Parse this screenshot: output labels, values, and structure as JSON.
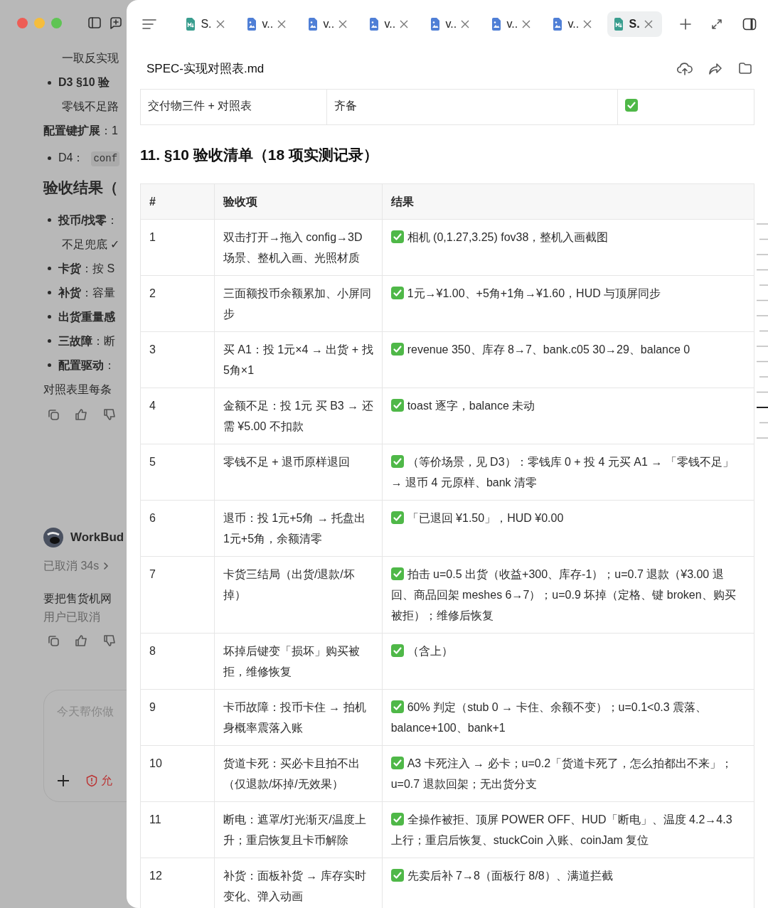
{
  "chat": {
    "blocks": [
      {
        "kind": "line",
        "text": "一取反实现"
      },
      {
        "kind": "bullet",
        "lines": [
          "**D3 §10 验**",
          "零钱不足路"
        ]
      },
      {
        "kind": "para",
        "text": "**配置键扩展**：1"
      },
      {
        "kind": "bullet",
        "lines": [
          "D4："
        ],
        "code": "conf"
      },
      {
        "kind": "heading",
        "text": "验收结果（"
      },
      {
        "kind": "bullet",
        "lines": [
          "**投币/找零**：",
          "不足兜底 ✓"
        ]
      },
      {
        "kind": "bullet",
        "lines": [
          "**卡货**：按 S"
        ]
      },
      {
        "kind": "bullet",
        "lines": [
          "**补货**：容量"
        ]
      },
      {
        "kind": "bullet",
        "lines": [
          "**出货重量感**"
        ]
      },
      {
        "kind": "bullet",
        "lines": [
          "**三故障**：断"
        ]
      },
      {
        "kind": "bullet",
        "lines": [
          "**配置驱动**："
        ]
      },
      {
        "kind": "para",
        "text": "对照表里每条"
      },
      {
        "kind": "actions"
      }
    ],
    "agent": {
      "name": "WorkBud",
      "status": "已取消 34s",
      "message": "要把售货机网",
      "note": "用户已取消"
    },
    "composer": {
      "placeholder": "今天帮你做",
      "warning": "允"
    }
  },
  "tabs": [
    {
      "label": "S.",
      "kind": "markdown",
      "selected": false
    },
    {
      "label": "v..",
      "kind": "image",
      "selected": false
    },
    {
      "label": "v..",
      "kind": "image",
      "selected": false
    },
    {
      "label": "v..",
      "kind": "image",
      "selected": false
    },
    {
      "label": "v..",
      "kind": "image",
      "selected": false
    },
    {
      "label": "v..",
      "kind": "image",
      "selected": false
    },
    {
      "label": "v..",
      "kind": "image",
      "selected": false
    },
    {
      "label": "S.",
      "kind": "markdown",
      "selected": true
    }
  ],
  "document": {
    "title": "SPEC-实现对照表.md",
    "top_row": {
      "cells": [
        "交付物三件 + 对照表",
        "齐备"
      ],
      "passed": true
    },
    "heading": "11. §10 验收清单（18 项实测记录）",
    "columns": [
      "#",
      "验收项",
      "结果"
    ],
    "rows": [
      {
        "num": "1",
        "item": "双击打开→拖入 config→3D 场景、整机入画、光照材质",
        "result": "相机 (0,1.27,3.25) fov38，整机入画截图",
        "passed": true
      },
      {
        "num": "2",
        "item": "三面额投币余额累加、小屏同步",
        "result": "1元→¥1.00、+5角+1角→¥1.60，HUD 与顶屏同步",
        "passed": true
      },
      {
        "num": "3",
        "item": "买 A1：投 1元×4 → 出货 + 找 5角×1",
        "result": "revenue 350、库存 8→7、bank.c05 30→29、balance 0",
        "passed": true
      },
      {
        "num": "4",
        "item": "金额不足：投 1元 买 B3 → 还需 ¥5.00 不扣款",
        "result": "toast 逐字，balance 未动",
        "passed": true
      },
      {
        "num": "5",
        "item": "零钱不足 + 退币原样退回",
        "result": "（等价场景，见 D3）：零钱库 0 + 投 4 元买 A1 → 「零钱不足」 → 退币 4 元原样、bank 清零",
        "passed": true
      },
      {
        "num": "6",
        "item": "退币：投 1元+5角 → 托盘出 1元+5角，余额清零",
        "result": "「已退回 ¥1.50」，HUD ¥0.00",
        "passed": true
      },
      {
        "num": "7",
        "item": "卡货三结局（出货/退款/坏掉）",
        "result": "拍击 u=0.5 出货（收益+300、库存-1）；u=0.7 退款（¥3.00 退回、商品回架 meshes 6→7）；u=0.9 坏掉（定格、键 broken、购买被拒）；维修后恢复",
        "passed": true
      },
      {
        "num": "8",
        "item": "坏掉后键变「损坏」购买被拒，维修恢复",
        "result": "（含上）",
        "passed": true
      },
      {
        "num": "9",
        "item": "卡币故障：投币卡住 → 拍机身概率震落入账",
        "result": "60% 判定（stub 0 → 卡住、余额不变）；u=0.1<0.3 震落、balance+100、bank+1",
        "passed": true
      },
      {
        "num": "10",
        "item": "货道卡死：买必卡且拍不出（仅退款/坏掉/无效果）",
        "result": "A3 卡死注入 → 必卡；u=0.2「货道卡死了，怎么拍都出不来」；u=0.7 退款回架；无出货分支",
        "passed": true
      },
      {
        "num": "11",
        "item": "断电：遮罩/灯光渐灭/温度上升；重启恢复且卡币解除",
        "result": "全操作被拒、顶屏 POWER OFF、HUD「断电」、温度 4.2→4.3 上行；重启后恢复、stuckCoin 入账、coinJam 复位",
        "passed": true
      },
      {
        "num": "12",
        "item": "补货：面板补货 → 库存实时变化、弹入动画",
        "result": "先卖后补 7→8（面板行 8/8）、满道拦截",
        "passed": true
      }
    ]
  }
}
